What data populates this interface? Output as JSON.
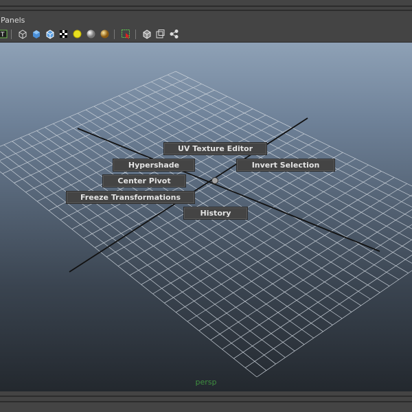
{
  "menu": {
    "panels": "Panels"
  },
  "toolbar": {
    "icons": [
      "t-icon",
      "wireframe-cube-icon",
      "smooth-shade-cube-icon",
      "shaded-wire-cube-icon",
      "checker-texture-icon",
      "light-bulb-icon",
      "grey-sphere-icon",
      "gold-sphere-icon",
      "select-cursor-icon",
      "isolate-cube-icon",
      "frame-cube-icon",
      "nodes-icon"
    ]
  },
  "marking_menu": {
    "uv_texture_editor": "UV Texture Editor",
    "hypershade": "Hypershade",
    "invert_selection": "Invert Selection",
    "center_pivot": "Center Pivot",
    "freeze_transformations": "Freeze Transformations",
    "history": "History"
  },
  "viewport": {
    "camera_label": "persp"
  }
}
